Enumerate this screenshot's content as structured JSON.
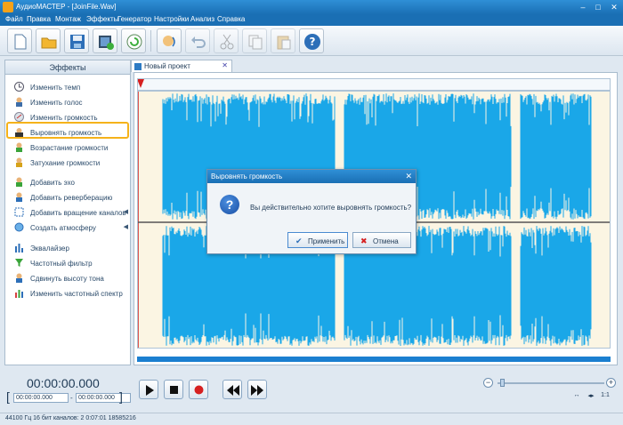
{
  "window": {
    "title": "АудиоМАСТЕР - [JoinFile.Wav]"
  },
  "menu": [
    "Файл",
    "Правка",
    "Монтаж",
    "Эффекты",
    "Генератор",
    "Настройки",
    "Анализ",
    "Справка"
  ],
  "toolbar": {
    "icons": [
      "new-file-icon",
      "open-folder-icon",
      "save-icon",
      "video-import-icon",
      "record-icon",
      "speech-icon",
      "undo-icon",
      "cut-icon",
      "copy-icon",
      "paste-icon",
      "help-icon"
    ]
  },
  "effects_panel": {
    "title": "Эффекты",
    "items": [
      {
        "label": "Изменить темп",
        "icon": "tempo-icon"
      },
      {
        "label": "Изменить голос",
        "icon": "voice-icon"
      },
      {
        "label": "Изменить громкость",
        "icon": "volume-icon"
      },
      {
        "label": "Выровнять громкость",
        "icon": "normalize-icon"
      },
      {
        "label": "Возрастание громкости",
        "icon": "fade-in-icon"
      },
      {
        "label": "Затухание громкости",
        "icon": "fade-out-icon"
      },
      {
        "label": "Добавить эхо",
        "icon": "echo-icon"
      },
      {
        "label": "Добавить реверберацию",
        "icon": "reverb-icon"
      },
      {
        "label": "Добавить вращение каналов",
        "icon": "rotate-icon"
      },
      {
        "label": "Создать атмосферу",
        "icon": "atmosphere-icon"
      },
      {
        "label": "Эквалайзер",
        "icon": "equalizer-icon"
      },
      {
        "label": "Частотный фильтр",
        "icon": "filter-icon"
      },
      {
        "label": "Сдвинуть высоту тона",
        "icon": "pitch-icon"
      },
      {
        "label": "Изменить частотный спектр",
        "icon": "spectrum-icon"
      }
    ]
  },
  "editor": {
    "tab_label": "Новый проект"
  },
  "dialog": {
    "title": "Выровнять громкость",
    "message": "Вы действительно хотите выровнять громкость?",
    "apply_label": "Применить",
    "cancel_label": "Отмена"
  },
  "transport": {
    "current_time": "00:00:00.000",
    "selection_start": "00:00:00.000",
    "selection_end": "00:00:00.000",
    "range_separator": "-"
  },
  "zoom": {
    "minus": "−",
    "plus": "+",
    "fit_label": "1:1"
  },
  "status": {
    "text": "44100 Гц  16 бит  каналов: 2  0:07:01  18585216"
  },
  "colors": {
    "accent": "#1b9be6",
    "waveform": "#1aa7e8",
    "highlight": "#f5b21a",
    "titlebar": "#1a6fb4"
  }
}
